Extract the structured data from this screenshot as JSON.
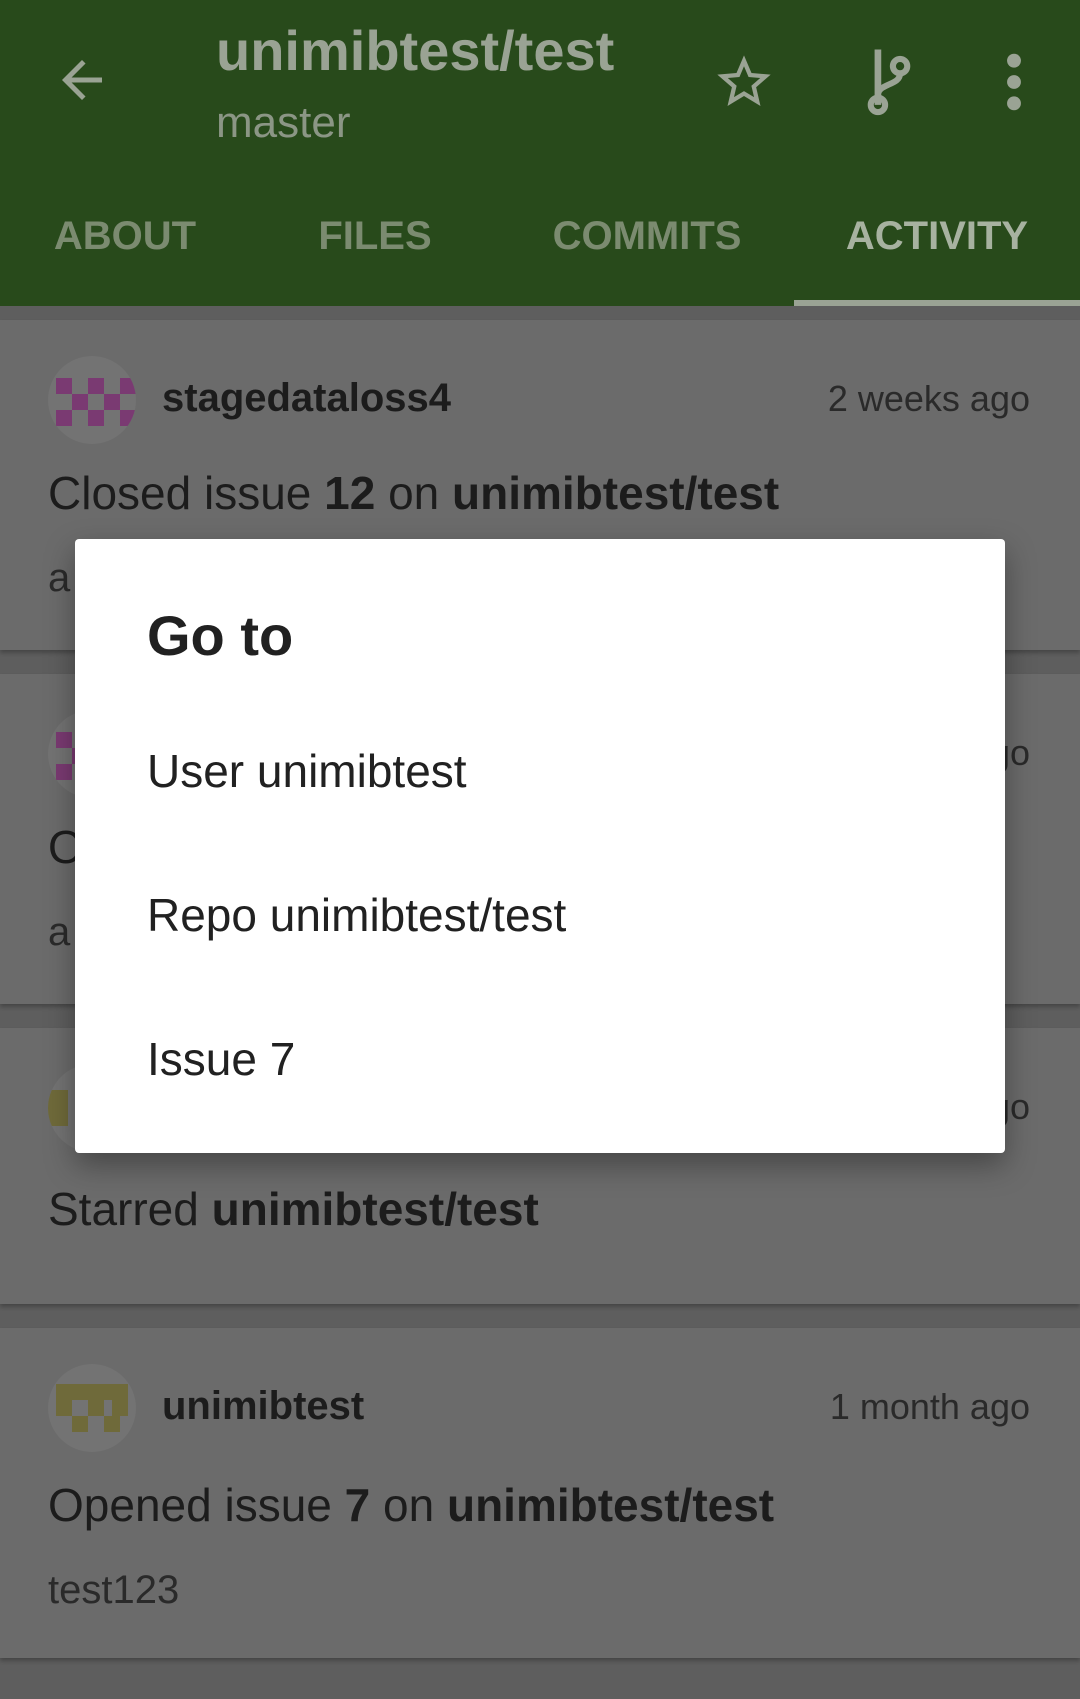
{
  "appbar": {
    "title": "unimibtest/test",
    "subtitle": "master",
    "icons": [
      "back-arrow-icon",
      "star-outline-icon",
      "git-branch-icon",
      "more-vert-icon"
    ]
  },
  "tabs": [
    {
      "label": "ABOUT"
    },
    {
      "label": "FILES"
    },
    {
      "label": "COMMITS"
    },
    {
      "label": "ACTIVITY",
      "selected": true
    }
  ],
  "feed": [
    {
      "user": "stagedataloss4",
      "time": "2 weeks ago",
      "action": {
        "verb": "Closed issue ",
        "number": "12",
        "mid": " on ",
        "repo": "unimibtest/test"
      },
      "detail_visible": "a"
    },
    {
      "time_visible": "go",
      "action_visible": "O",
      "detail_visible": "a"
    },
    {
      "time_visible": "go",
      "action": {
        "verb": "Starred ",
        "repo": "unimibtest/test"
      }
    },
    {
      "user": "unimibtest",
      "time": "1 month ago",
      "action": {
        "verb": "Opened issue ",
        "number": "7",
        "mid": " on ",
        "repo": "unimibtest/test"
      },
      "detail": "test123"
    }
  ],
  "dialog": {
    "title": "Go to",
    "items": [
      "User unimibtest",
      "Repo unimibtest/test",
      "Issue 7"
    ]
  },
  "colors": {
    "appbar": "#284a1b",
    "scrim_card": "#6b6b6b",
    "dialog_bg": "#ffffff",
    "avatar_magenta": "#7a3a72",
    "avatar_olive": "#6f6a3a"
  }
}
